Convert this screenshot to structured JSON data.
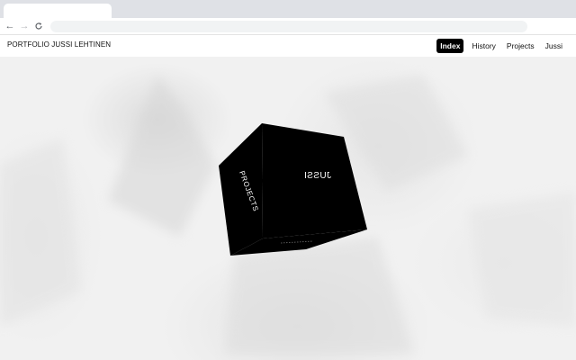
{
  "site": {
    "title": "PORTFOLIO JUSSI LEHTINEN"
  },
  "nav": {
    "items": [
      {
        "label": "Index",
        "active": true
      },
      {
        "label": "History",
        "active": false
      },
      {
        "label": "Projects",
        "active": false
      },
      {
        "label": "Jussi",
        "active": false
      }
    ]
  },
  "cube": {
    "left_face_label": "PROJECTS",
    "front_face_label": "JUSSI",
    "color": "#000000"
  },
  "browser": {
    "back_icon": "arrow-left-icon",
    "forward_icon": "arrow-right-icon",
    "reload_icon": "reload-icon"
  }
}
